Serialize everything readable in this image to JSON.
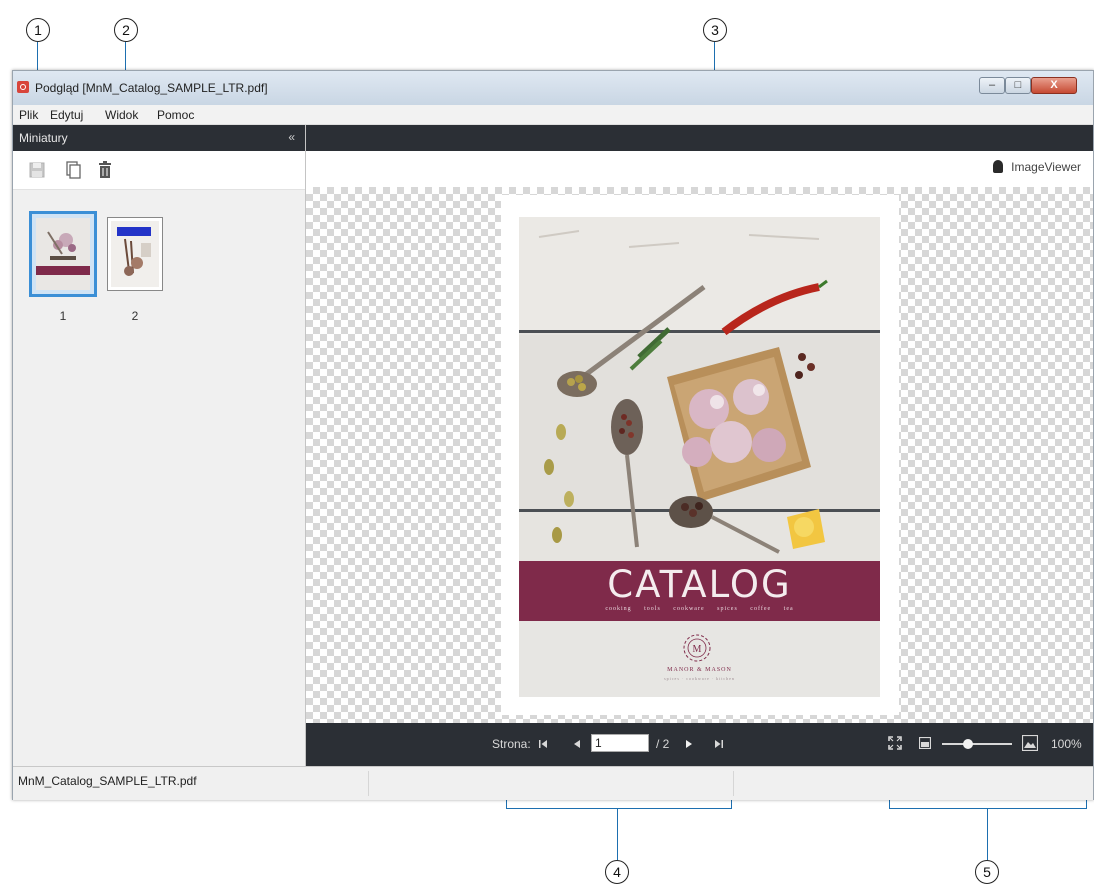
{
  "callouts": [
    "1",
    "2",
    "3",
    "4",
    "5"
  ],
  "window": {
    "title": "Podgląd [MnM_Catalog_SAMPLE_LTR.pdf]",
    "controls": {
      "minimize": "–",
      "maximize": "□",
      "close": "X"
    }
  },
  "menu": {
    "items": [
      "Plik",
      "Edytuj",
      "Widok",
      "Pomoc"
    ]
  },
  "sidebar": {
    "title": "Miniatury",
    "collapse_icon": "«",
    "tools": [
      "save-icon",
      "copy-icon",
      "trash-icon"
    ],
    "thumbnails": [
      {
        "number": "1",
        "selected": true
      },
      {
        "number": "2",
        "selected": false
      }
    ]
  },
  "viewer": {
    "brand": "ImageViewer",
    "page": {
      "title": "CATALOG",
      "subtitle": "cooking tools   cookware   spices   coffee   tea",
      "logo_letter": "M",
      "brand_name": "MANOR & MASON",
      "brand_tagline": "spices · cookware · kitchen"
    },
    "nav": {
      "label": "Strona:",
      "current_page": "1",
      "total_pages": "/ 2"
    },
    "zoom": {
      "value": "100%",
      "level_percent": 35
    }
  },
  "status": {
    "file": "MnM_Catalog_SAMPLE_LTR.pdf"
  },
  "colors": {
    "dark_bar": "#2b2f35",
    "selection_blue": "#3b8fd6",
    "banner": "#7f2a4a",
    "callout_line": "#1d6fb0"
  }
}
